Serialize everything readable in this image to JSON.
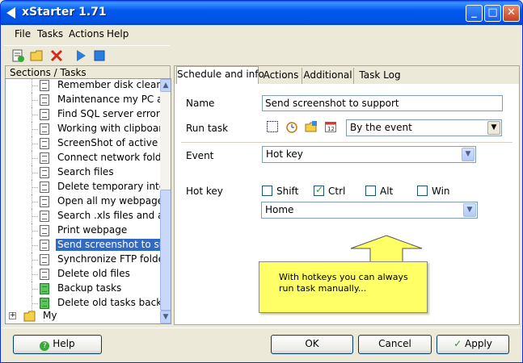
{
  "window": {
    "title": "xStarter 1.71"
  },
  "menu": {
    "file": "File",
    "tasks": "Tasks",
    "actions": "Actions",
    "help": "Help"
  },
  "toolbar": {
    "icons": [
      "new-task-icon",
      "open-folder-icon",
      "delete-icon",
      "run-icon",
      "stop-icon"
    ]
  },
  "sidebar": {
    "header": "Sections / Tasks",
    "items": [
      {
        "label": "Remember disk cleanu...",
        "icon": "task-doc-icon"
      },
      {
        "label": "Maintenance my PC an...",
        "icon": "task-doc-icon"
      },
      {
        "label": "Find SQL server errors",
        "icon": "task-doc-icon"
      },
      {
        "label": "Working with clipboard ...",
        "icon": "task-doc-icon"
      },
      {
        "label": "ScreenShot of active w...",
        "icon": "task-doc-icon"
      },
      {
        "label": "Connect network folders",
        "icon": "task-doc-icon"
      },
      {
        "label": "Search files",
        "icon": "task-doc-icon"
      },
      {
        "label": "Delete temporary intern...",
        "icon": "task-doc-icon"
      },
      {
        "label": "Open all my webpages",
        "icon": "task-doc-icon"
      },
      {
        "label": "Search .xls files and arc...",
        "icon": "task-doc-icon"
      },
      {
        "label": "Print webpage",
        "icon": "task-doc-icon"
      },
      {
        "label": "Send screenshot to sup...",
        "icon": "task-doc-icon",
        "selected": true
      },
      {
        "label": "Synchronize FTP folder...",
        "icon": "task-doc-icon"
      },
      {
        "label": "Delete old files",
        "icon": "task-doc-icon"
      },
      {
        "label": "Backup tasks",
        "icon": "task-green-icon"
      },
      {
        "label": "Delete old tasks backups",
        "icon": "task-green-icon"
      }
    ],
    "folder": {
      "label": "My",
      "icon": "folder-icon"
    }
  },
  "tabs": [
    {
      "label": "Schedule and info",
      "active": true
    },
    {
      "label": "Actions",
      "active": false
    },
    {
      "label": "Additional",
      "active": false
    },
    {
      "label": "Task Log",
      "active": false
    }
  ],
  "form": {
    "name_label": "Name",
    "name_value": "Send screenshot to support",
    "run_task_label": "Run task",
    "run_task_value": "By the event",
    "event_label": "Event",
    "event_value": "Hot key",
    "hotkey_label": "Hot key",
    "modifiers": [
      {
        "label": "Shift",
        "checked": false
      },
      {
        "label": "Ctrl",
        "checked": true
      },
      {
        "label": "Alt",
        "checked": false
      },
      {
        "label": "Win",
        "checked": false
      }
    ],
    "key_value": "Home"
  },
  "tooltip": {
    "text": "With hotkeys you can always run task manually..."
  },
  "buttons": {
    "help": "Help",
    "ok": "OK",
    "cancel": "Cancel",
    "apply": "Apply"
  },
  "colors": {
    "selection": "#316ac5",
    "tooltip": "#ffff66",
    "titlebar": "#0058ee"
  }
}
